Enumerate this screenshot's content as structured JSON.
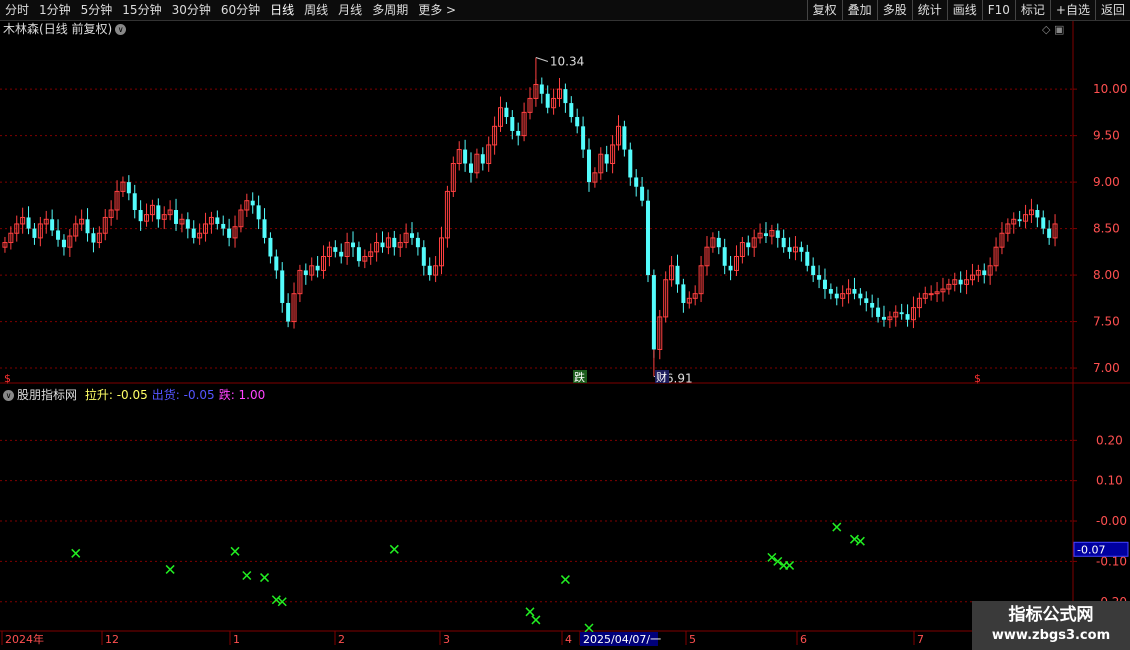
{
  "toolbar": {
    "periods": [
      "分时",
      "1分钟",
      "5分钟",
      "15分钟",
      "30分钟",
      "60分钟",
      "日线",
      "周线",
      "月线",
      "多周期",
      "更多 >"
    ],
    "active_period": "日线",
    "buttons": [
      "复权",
      "叠加",
      "多股",
      "统计",
      "画线",
      "F10",
      "标记",
      "+自选",
      "返回"
    ]
  },
  "stock": {
    "name": "木林森",
    "mode": "(日线 前复权)"
  },
  "price_axis": {
    "ticks": [
      "10.00",
      "9.50",
      "9.00",
      "8.50",
      "8.00",
      "7.50",
      "7.00"
    ]
  },
  "high_label": "10.34",
  "low_label": "6.91",
  "event_markers": [
    {
      "text": "跌",
      "type": "fall"
    },
    {
      "text": "财",
      "type": "finance"
    }
  ],
  "dividend_markers": [
    "$",
    "$"
  ],
  "indicator": {
    "name": "股朋指标网",
    "items": [
      {
        "label": "拉升:",
        "value": "-0.05",
        "color": "#ffff66"
      },
      {
        "label": "出货:",
        "value": "-0.05",
        "color": "#5555ff"
      },
      {
        "label": "跌:",
        "value": "1.00",
        "color": "#ff44ff"
      }
    ],
    "axis_ticks": [
      "0.20",
      "0.10",
      "-0.00",
      "-0.10",
      "-0.20"
    ],
    "current_value": "-0.07"
  },
  "date_axis": {
    "labels": [
      "2024年",
      "12",
      "1",
      "2",
      "3",
      "4",
      "2025/04/07/一",
      "5",
      "6",
      "7"
    ]
  },
  "watermark": {
    "title": "指标公式网",
    "url": "www.zbgs3.com"
  },
  "colors": {
    "up": "#ff4040",
    "down": "#54fcfc",
    "grid": "#800000",
    "signal": "#22ee22",
    "text": "#dddddd"
  },
  "chart_data": {
    "type": "candlestick",
    "price_range": [
      6.85,
      10.55
    ],
    "indicator_range": [
      -0.27,
      0.29
    ],
    "closes": [
      8.35,
      8.45,
      8.55,
      8.62,
      8.5,
      8.4,
      8.55,
      8.6,
      8.48,
      8.38,
      8.3,
      8.42,
      8.55,
      8.6,
      8.45,
      8.35,
      8.45,
      8.62,
      8.7,
      8.9,
      9.0,
      8.88,
      8.7,
      8.58,
      8.65,
      8.75,
      8.6,
      8.65,
      8.7,
      8.55,
      8.6,
      8.5,
      8.4,
      8.45,
      8.55,
      8.62,
      8.55,
      8.5,
      8.4,
      8.52,
      8.7,
      8.8,
      8.75,
      8.6,
      8.4,
      8.2,
      8.05,
      7.7,
      7.5,
      7.8,
      8.05,
      8.0,
      8.1,
      8.05,
      8.2,
      8.3,
      8.25,
      8.2,
      8.35,
      8.3,
      8.15,
      8.2,
      8.25,
      8.35,
      8.3,
      8.4,
      8.3,
      8.35,
      8.45,
      8.4,
      8.3,
      8.1,
      8.0,
      8.1,
      8.4,
      8.9,
      9.2,
      9.35,
      9.2,
      9.1,
      9.3,
      9.2,
      9.4,
      9.6,
      9.8,
      9.7,
      9.55,
      9.5,
      9.75,
      9.9,
      10.05,
      9.95,
      9.8,
      9.9,
      10.0,
      9.85,
      9.7,
      9.6,
      9.35,
      9.0,
      9.1,
      9.3,
      9.2,
      9.4,
      9.6,
      9.35,
      9.05,
      8.95,
      8.8,
      8.0,
      7.2,
      7.55,
      7.95,
      8.1,
      7.9,
      7.7,
      7.75,
      7.8,
      8.1,
      8.3,
      8.4,
      8.3,
      8.1,
      8.05,
      8.2,
      8.35,
      8.3,
      8.4,
      8.45,
      8.42,
      8.48,
      8.4,
      8.3,
      8.25,
      8.3,
      8.25,
      8.1,
      8.0,
      7.95,
      7.85,
      7.8,
      7.75,
      7.8,
      7.85,
      7.8,
      7.75,
      7.7,
      7.65,
      7.55,
      7.52,
      7.55,
      7.6,
      7.58,
      7.52,
      7.65,
      7.75,
      7.8,
      7.8,
      7.82,
      7.85,
      7.9,
      7.95,
      7.9,
      7.95,
      8.0,
      8.05,
      8.0,
      8.1,
      8.3,
      8.45,
      8.55,
      8.6,
      8.58,
      8.65,
      8.7,
      8.62,
      8.5,
      8.4,
      8.55
    ],
    "signals": [
      {
        "i": 12,
        "v": -0.08
      },
      {
        "i": 28,
        "v": -0.12
      },
      {
        "i": 39,
        "v": -0.075
      },
      {
        "i": 41,
        "v": -0.135
      },
      {
        "i": 44,
        "v": -0.14
      },
      {
        "i": 46,
        "v": -0.195
      },
      {
        "i": 47,
        "v": -0.2
      },
      {
        "i": 66,
        "v": -0.07
      },
      {
        "i": 89,
        "v": -0.225
      },
      {
        "i": 90,
        "v": -0.245
      },
      {
        "i": 95,
        "v": -0.145
      },
      {
        "i": 99,
        "v": -0.265
      },
      {
        "i": 130,
        "v": -0.09
      },
      {
        "i": 131,
        "v": -0.1
      },
      {
        "i": 132,
        "v": -0.11
      },
      {
        "i": 133,
        "v": -0.11
      },
      {
        "i": 141,
        "v": -0.015
      },
      {
        "i": 144,
        "v": -0.045
      },
      {
        "i": 145,
        "v": -0.05
      }
    ]
  }
}
